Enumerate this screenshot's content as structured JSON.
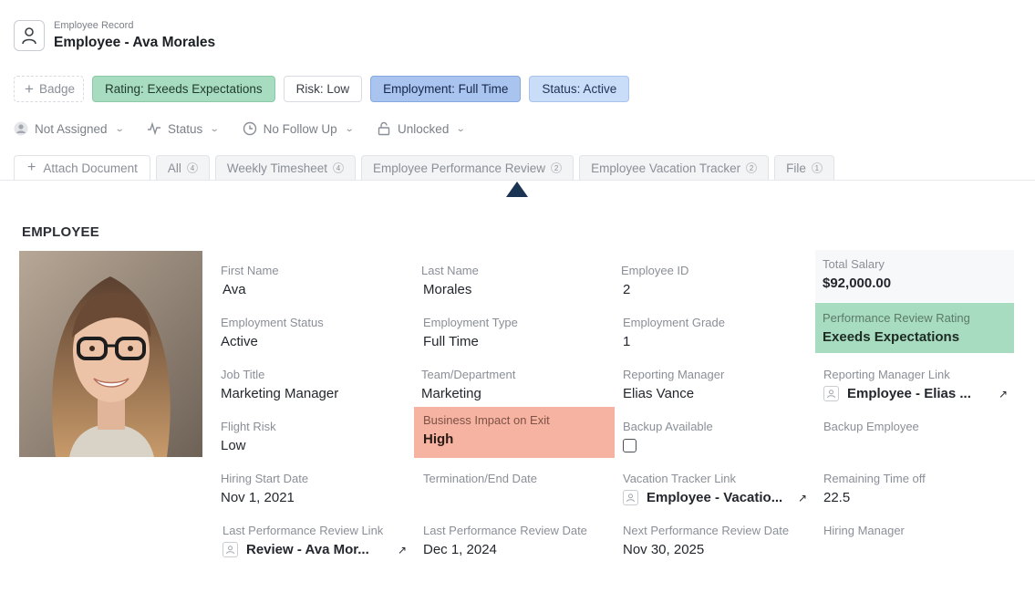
{
  "header": {
    "subtitle": "Employee Record",
    "title": "Employee - Ava Morales",
    "icon": "user-icon"
  },
  "badges": {
    "add_label": "Badge",
    "rating": "Rating: Exeeds Expectations",
    "risk": "Risk: Low",
    "employment": "Employment: Full Time",
    "status": "Status: Active"
  },
  "filters": {
    "assignee": "Not Assigned",
    "status": "Status",
    "follow_up": "No Follow Up",
    "lock": "Unlocked"
  },
  "tabs": {
    "attach_label": "Attach Document",
    "items": [
      {
        "label": "All",
        "count": "4"
      },
      {
        "label": "Weekly Timesheet",
        "count": "4"
      },
      {
        "label": "Employee Performance Review",
        "count": "2"
      },
      {
        "label": "Employee Vacation Tracker",
        "count": "2"
      },
      {
        "label": "File",
        "count": "1"
      }
    ]
  },
  "section": {
    "title": "EMPLOYEE"
  },
  "colors": {
    "green": "#a8dcc0",
    "blue": "#a9c4ef",
    "light_blue": "#c9dcf8",
    "red": "#f6b3a1",
    "caret": "#1c3454"
  },
  "fields": {
    "first_name": {
      "label": "First Name",
      "value": "Ava"
    },
    "last_name": {
      "label": "Last Name",
      "value": "Morales"
    },
    "employee_id": {
      "label": "Employee ID",
      "value": "2"
    },
    "total_salary": {
      "label": "Total Salary",
      "value": "$92,000.00"
    },
    "employment_status": {
      "label": "Employment Status",
      "value": "Active"
    },
    "employment_type": {
      "label": "Employment Type",
      "value": "Full Time"
    },
    "employment_grade": {
      "label": "Employment Grade",
      "value": "1"
    },
    "performance_rating": {
      "label": "Performance Review Rating",
      "value": "Exeeds Expectations"
    },
    "job_title": {
      "label": "Job Title",
      "value": "Marketing Manager"
    },
    "team": {
      "label": "Team/Department",
      "value": "Marketing"
    },
    "reporting_manager": {
      "label": "Reporting Manager",
      "value": "Elias Vance"
    },
    "reporting_manager_link": {
      "label": "Reporting Manager Link",
      "value": "Employee - Elias ..."
    },
    "flight_risk": {
      "label": "Flight Risk",
      "value": "Low"
    },
    "business_impact": {
      "label": "Business Impact on Exit",
      "value": "High"
    },
    "backup_available": {
      "label": "Backup Available",
      "checked": false
    },
    "backup_employee": {
      "label": "Backup Employee",
      "value": ""
    },
    "hiring_start": {
      "label": "Hiring Start Date",
      "value": "Nov 1, 2021"
    },
    "termination": {
      "label": "Termination/End Date",
      "value": ""
    },
    "vacation_link": {
      "label": "Vacation Tracker Link",
      "value": "Employee - Vacatio..."
    },
    "remaining_time": {
      "label": "Remaining Time off",
      "value": "22.5"
    },
    "last_review_link": {
      "label": "Last Performance Review Link",
      "value": "Review - Ava Mor..."
    },
    "last_review_date": {
      "label": "Last Performance Review Date",
      "value": "Dec 1, 2024"
    },
    "next_review_date": {
      "label": "Next Performance Review Date",
      "value": "Nov 30, 2025"
    },
    "hiring_manager": {
      "label": "Hiring Manager",
      "value": ""
    }
  }
}
